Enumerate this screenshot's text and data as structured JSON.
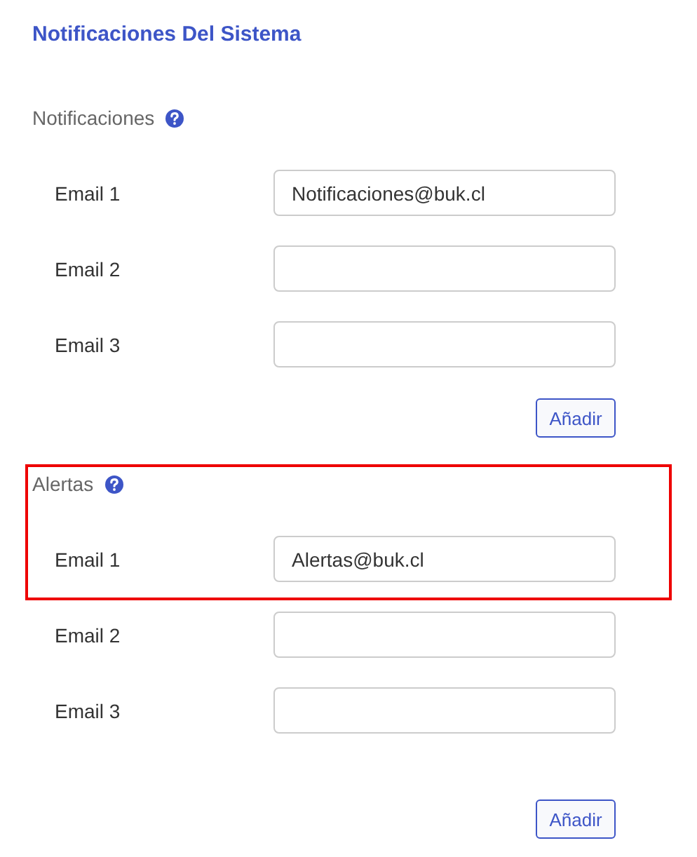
{
  "title": "Notificaciones Del Sistema",
  "sections": [
    {
      "heading": "Notificaciones",
      "highlighted": false,
      "rows": [
        {
          "label": "Email 1",
          "value": "Notificaciones@buk.cl",
          "highlighted": false
        },
        {
          "label": "Email 2",
          "highlighted": false
        },
        {
          "label": "Email 3",
          "highlighted": false
        }
      ],
      "button": "Añadir"
    },
    {
      "heading": "Alertas",
      "highlighted": true,
      "rows": [
        {
          "label": "Email 1",
          "value": "Alertas@buk.cl",
          "highlighted": true
        },
        {
          "label": "Email 2",
          "highlighted": false
        },
        {
          "label": "Email 3",
          "highlighted": false
        }
      ],
      "button": "Añadir"
    }
  ]
}
